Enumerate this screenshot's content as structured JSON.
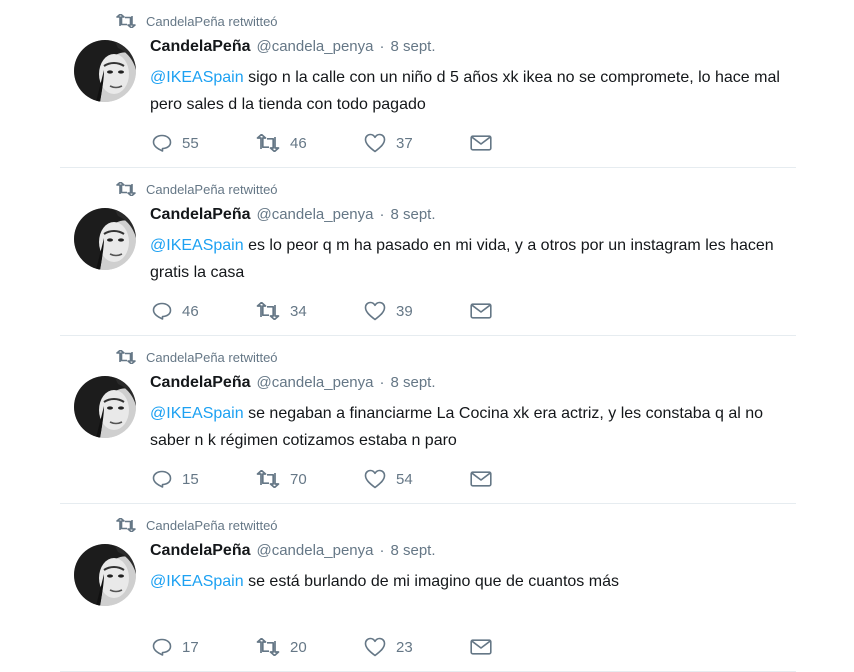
{
  "tweets": [
    {
      "retweeted_by": "CandelaPeña retwitteó",
      "name": "CandelaPeña",
      "handle": "@candela_penya",
      "dot": "·",
      "time": "8 sept.",
      "mention": "@IKEASpain",
      "body": " sigo n la calle con un niño d 5 años xk ikea no se compromete, lo hace mal pero sales d la tienda con todo pagado",
      "replies": "55",
      "retweets": "46",
      "likes": "37"
    },
    {
      "retweeted_by": "CandelaPeña retwitteó",
      "name": "CandelaPeña",
      "handle": "@candela_penya",
      "dot": "·",
      "time": "8 sept.",
      "mention": "@IKEASpain",
      "body": " es lo peor q m ha pasado en mi vida, y a otros por un instagram les hacen gratis la casa",
      "replies": "46",
      "retweets": "34",
      "likes": "39"
    },
    {
      "retweeted_by": "CandelaPeña retwitteó",
      "name": "CandelaPeña",
      "handle": "@candela_penya",
      "dot": "·",
      "time": "8 sept.",
      "mention": "@IKEASpain",
      "body": " se negaban a financiarme La Cocina xk era actriz, y les constaba q al no saber n k régimen cotizamos estaba n paro",
      "replies": "15",
      "retweets": "70",
      "likes": "54"
    },
    {
      "retweeted_by": "CandelaPeña retwitteó",
      "name": "CandelaPeña",
      "handle": "@candela_penya",
      "dot": "·",
      "time": "8 sept.",
      "mention": "@IKEASpain",
      "body": " se está burlando de mi imagino que de cuantos más",
      "replies": "17",
      "retweets": "20",
      "likes": "23"
    }
  ],
  "icons": {
    "retweet": "retweet-icon",
    "reply": "reply-icon",
    "like": "heart-icon",
    "message": "envelope-icon"
  },
  "colors": {
    "mention": "#1da1f2",
    "secondary_text": "#657786",
    "divider": "#e6ecf0"
  }
}
